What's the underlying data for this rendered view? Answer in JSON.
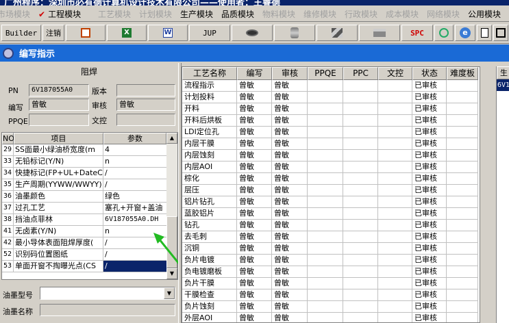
{
  "app_title": "广州程序：深圳市必有德计算机设计技术有限公司——使用者：王睿德",
  "menu": [
    {
      "label": "市场模块",
      "active": false
    },
    {
      "label": "工程模块",
      "active": true,
      "checked": true
    },
    {
      "label": "工艺模块",
      "active": false
    },
    {
      "label": "计划模块",
      "active": false
    },
    {
      "label": "生产模块",
      "active": true
    },
    {
      "label": "品质模块",
      "active": true
    },
    {
      "label": "物料模块",
      "active": false
    },
    {
      "label": "维修模块",
      "active": false
    },
    {
      "label": "行政模块",
      "active": false
    },
    {
      "label": "成本模块",
      "active": false
    },
    {
      "label": "网络模块",
      "active": false
    },
    {
      "label": "公用模块",
      "active": true
    }
  ],
  "toolbar": {
    "builder": "Builder",
    "logout": "注销",
    "excel_glyph": "X",
    "word_glyph": "W",
    "jup": "JUP",
    "spc": "SPC",
    "ie_glyph": "e"
  },
  "window_title": "编写指示",
  "left": {
    "section_title": "阻焊",
    "pn_label": "PN",
    "pn_value": "6V187055A0",
    "version_label": "版本",
    "version_value": "",
    "author_label": "编写",
    "author_value": "曾敏",
    "reviewer_label": "审核",
    "reviewer_value": "曾敏",
    "ppqe_label": "PPQE",
    "ppqe_value": "",
    "doc_control_label": "文控",
    "doc_control_value": "",
    "grid_headers": {
      "no": "NO",
      "item": "项目",
      "param": "参数"
    },
    "rows": [
      {
        "no": "29",
        "item": "SS面最小绿油桥宽度(m",
        "param": "4"
      },
      {
        "no": "33",
        "item": "无铅标记(Y/N)",
        "param": "n"
      },
      {
        "no": "34",
        "item": "快捷标记(FP+UL+DateCo",
        "param": "/"
      },
      {
        "no": "35",
        "item": "生产周期(YYWW/WWYY)",
        "param": "/"
      },
      {
        "no": "36",
        "item": "油墨颜色",
        "param": "绿色"
      },
      {
        "no": "37",
        "item": "过孔工艺",
        "param": "塞孔+开窗+盖油"
      },
      {
        "no": "38",
        "item": "挡油点菲林",
        "param": "6V187055A0.DH"
      },
      {
        "no": "41",
        "item": "无卤素(Y/N)",
        "param": "n"
      },
      {
        "no": "42",
        "item": "最小导体表面阻焊厚度(",
        "param": "/"
      },
      {
        "no": "52",
        "item": "识别码位置图纸",
        "param": "/"
      },
      {
        "no": "53",
        "item": "单面开窗不掏曝光点(CS",
        "param": "/"
      }
    ],
    "ink_type_label": "油墨型号",
    "ink_type_value": "",
    "ink_name_label": "油墨名称",
    "ink_name_value": ""
  },
  "right": {
    "headers": [
      "工艺名称",
      "编写",
      "审核",
      "PPQE",
      "PPC",
      "文控",
      "状态",
      "难度板"
    ],
    "rows": [
      {
        "name": "流程指示",
        "author": "曾敏",
        "reviewer": "曾敏",
        "status": "已审核"
      },
      {
        "name": "计划投料",
        "author": "曾敏",
        "reviewer": "曾敏",
        "status": "已审核"
      },
      {
        "name": "开料",
        "author": "曾敏",
        "reviewer": "曾敏",
        "status": "已审核"
      },
      {
        "name": "开料后烘板",
        "author": "曾敏",
        "reviewer": "曾敏",
        "status": "已审核"
      },
      {
        "name": "LDI定位孔",
        "author": "曾敏",
        "reviewer": "曾敏",
        "status": "已审核"
      },
      {
        "name": "内层干膜",
        "author": "曾敏",
        "reviewer": "曾敏",
        "status": "已审核"
      },
      {
        "name": "内层蚀刻",
        "author": "曾敏",
        "reviewer": "曾敏",
        "status": "已审核"
      },
      {
        "name": "内层AOI",
        "author": "曾敏",
        "reviewer": "曾敏",
        "status": "已审核"
      },
      {
        "name": "棕化",
        "author": "曾敏",
        "reviewer": "曾敏",
        "status": "已审核"
      },
      {
        "name": "层压",
        "author": "曾敏",
        "reviewer": "曾敏",
        "status": "已审核"
      },
      {
        "name": "铝片钻孔",
        "author": "曾敏",
        "reviewer": "曾敏",
        "status": "已审核"
      },
      {
        "name": "蓝胶铝片",
        "author": "曾敏",
        "reviewer": "曾敏",
        "status": "已审核"
      },
      {
        "name": "钻孔",
        "author": "曾敏",
        "reviewer": "曾敏",
        "status": "已审核"
      },
      {
        "name": "去毛刺",
        "author": "曾敏",
        "reviewer": "曾敏",
        "status": "已审核"
      },
      {
        "name": "沉铜",
        "author": "曾敏",
        "reviewer": "曾敏",
        "status": "已审核"
      },
      {
        "name": "负片电镀",
        "author": "曾敏",
        "reviewer": "曾敏",
        "status": "已审核"
      },
      {
        "name": "负电镀磨板",
        "author": "曾敏",
        "reviewer": "曾敏",
        "status": "已审核"
      },
      {
        "name": "负片干膜",
        "author": "曾敏",
        "reviewer": "曾敏",
        "status": "已审核"
      },
      {
        "name": "干膜检查",
        "author": "曾敏",
        "reviewer": "曾敏",
        "status": "已审核"
      },
      {
        "name": "负片蚀刻",
        "author": "曾敏",
        "reviewer": "曾敏",
        "status": "已审核"
      },
      {
        "name": "外层AOI",
        "author": "曾敏",
        "reviewer": "曾敏",
        "status": "已审核"
      }
    ]
  },
  "far_right": {
    "header": "生",
    "cell": "6V1"
  },
  "colors": {
    "title_bar": "#1a6ad6",
    "selection": "#0a246a",
    "arrow": "#22bb22",
    "check": "#d00000"
  }
}
